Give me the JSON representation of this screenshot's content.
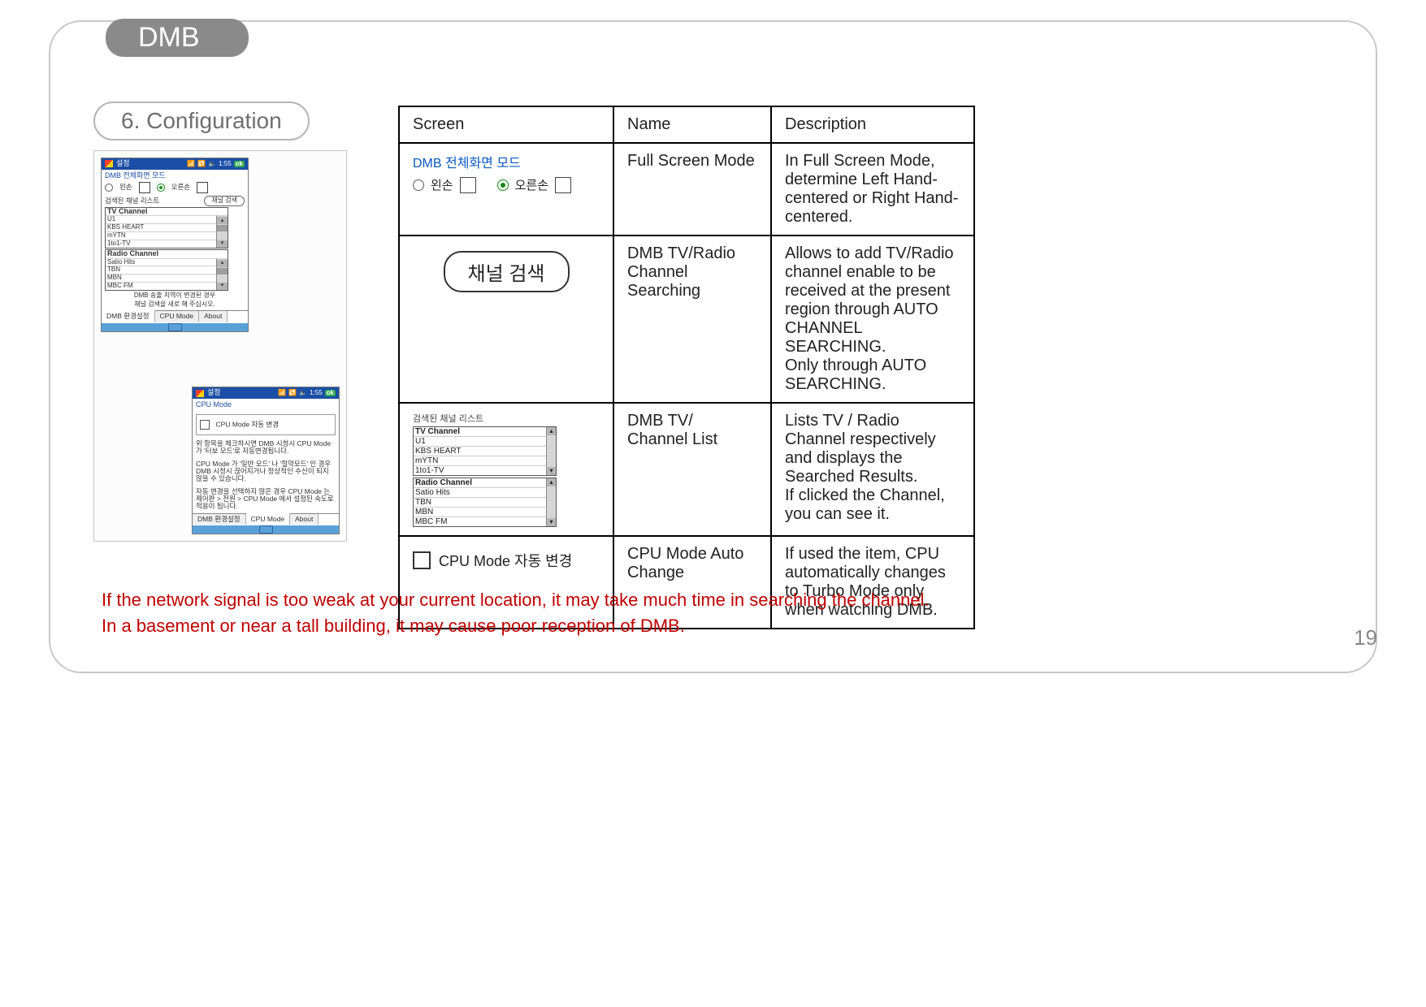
{
  "page_title": "DMB",
  "section_title": "6. Configuration",
  "page_number": "19",
  "pda_common": {
    "titlebar_label": "설정",
    "time": "1:55",
    "ok": "ok",
    "bottom_tabs": [
      "DMB 환경설정",
      "CPU Mode",
      "About"
    ]
  },
  "pda_main": {
    "mode_label": "DMB 전체화면 모드",
    "left_hand": "왼손",
    "right_hand": "오른손",
    "searched_label": "검색된 채널 리스트",
    "search_btn": "채널 검색",
    "tv_header": "TV Channel",
    "radio_header": "Radio Channel",
    "tv_channels": [
      "U1",
      "KBS HEART",
      "mYTN",
      "1to1-TV"
    ],
    "radio_channels": [
      "Satio Hits",
      "TBN",
      "MBN",
      "MBC FM"
    ],
    "note1": "DMB 송출 지역이 변경된 경우",
    "note2": "채널 검색을 새로 해 주십시오."
  },
  "pda_cpu": {
    "tab_label": "CPU Mode",
    "checkbox_label": "CPU Mode 자동 변경",
    "desc1": "위 항목을 체크하시면 DMB 시청시 CPU Mode 가 '터보 모드'로 자동변경됩니다.",
    "desc2": "CPU Mode 가 '일반 모드' 나 '절약모드' 인 경우 DMB 시청시 끊어지거나 정상적인 수신이 되지 않을 수 있습니다.",
    "desc3": "자동 변경을 선택하지 않은 경우 CPU Mode 는 제어판 > 전원 > CPU Mode 에서 설정된 속도로 적용이 됩니다."
  },
  "table": {
    "headers": {
      "screen": "Screen",
      "name": "Name",
      "description": "Description"
    },
    "rows": [
      {
        "snip": {
          "title": "DMB 전체화면 모드",
          "left": "왼손",
          "right": "오른손"
        },
        "name": "Full Screen Mode",
        "desc": "In Full Screen Mode, determine Left Hand-centered or Right Hand-centered."
      },
      {
        "snip": {
          "button": "채널 검색"
        },
        "name": "DMB TV/Radio Channel Searching",
        "desc": "Allows to add TV/Radio channel enable to be received at the present region through AUTO CHANNEL SEARCHING.\nOnly through AUTO SEARCHING."
      },
      {
        "snip": {
          "searched_label": "검색된 채널 리스트",
          "tv_header": "TV Channel",
          "radio_header": "Radio Channel",
          "tv_channels": [
            "U1",
            "KBS HEART",
            "mYTN",
            "1to1-TV"
          ],
          "radio_channels": [
            "Satio Hits",
            "TBN",
            "MBN",
            "MBC FM"
          ]
        },
        "name": "DMB TV/ Channel List",
        "desc": "Lists TV / Radio Channel respectively and displays the Searched Results.\nIf clicked the Channel, you can see it."
      },
      {
        "snip": {
          "checkbox_label": "CPU Mode 자동 변경"
        },
        "name": "CPU Mode Auto Change",
        "desc": "If used the item, CPU automatically changes to Turbo Mode only when watching DMB."
      }
    ]
  },
  "warning": {
    "line1": "If the network signal is too weak at your current location, it may take much time in searching the channel.",
    "line2": "In a basement or near a tall building, it may cause poor reception of DMB."
  }
}
